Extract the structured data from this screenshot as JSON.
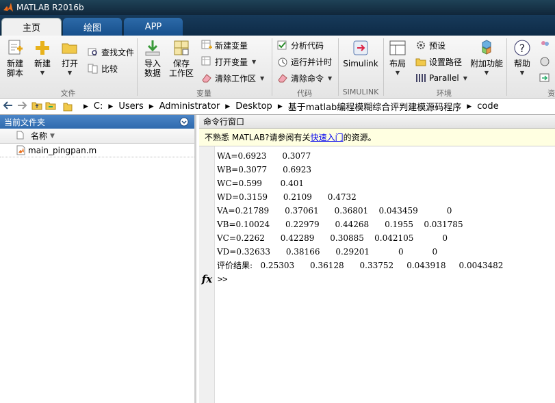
{
  "window": {
    "title": "MATLAB R2016b"
  },
  "tabs": [
    {
      "label": "主页"
    },
    {
      "label": "绘图"
    },
    {
      "label": "APP"
    }
  ],
  "ribbon": {
    "file": {
      "new_script": "新建\n脚本",
      "new": "新建",
      "open": "打开",
      "find_files": "查找文件",
      "compare": "比较",
      "group_label": "文件"
    },
    "variable": {
      "import": "导入\n数据",
      "save_workspace": "保存\n工作区",
      "new_variable": "新建变量",
      "open_variable": "打开变量",
      "clear_workspace": "清除工作区",
      "group_label": "变量"
    },
    "code": {
      "analyze": "分析代码",
      "run_time": "运行并计时",
      "clear_commands": "清除命令",
      "group_label": "代码"
    },
    "simulink": {
      "simulink": "Simulink",
      "group_label": "SIMULINK"
    },
    "env": {
      "layout": "布局",
      "preferences": "预设",
      "set_path": "设置路径",
      "parallel": "Parallel",
      "addons": "附加功能",
      "group_label": "环境"
    },
    "resources": {
      "help": "帮助",
      "group_label": "资"
    }
  },
  "address": {
    "segments": [
      "C:",
      "Users",
      "Administrator",
      "Desktop",
      "基于matlab编程模糊综合评判建模源码程序",
      "code"
    ]
  },
  "current_folder": {
    "title": "当前文件夹",
    "column_name": "名称",
    "files": [
      {
        "name": "main_pingpan.m"
      }
    ]
  },
  "command_window": {
    "title": "命令行窗口",
    "notice_prefix": "不熟悉 MATLAB?请参阅有关",
    "notice_link": "快速入门",
    "notice_suffix": "的资源。",
    "output": [
      "WA=0.6923      0.3077",
      "WB=0.3077      0.6923",
      "WC=0.599       0.401",
      "WD=0.3159      0.2109      0.4732",
      "VA=0.21789      0.37061      0.36801    0.043459           0",
      "VB=0.10024      0.22979      0.44268      0.1955    0.031785",
      "VC=0.2262      0.42289      0.30885    0.042105           0",
      "VD=0.32633      0.38166      0.29201           0           0",
      "评价结果:   0.25303      0.36128      0.33752     0.043918     0.0043482"
    ],
    "prompt": ">>",
    "fx": "fx"
  },
  "colors": {
    "title_bar": "#10263a",
    "panel_header": "#2f6aad",
    "notice_bg": "#ffffe1",
    "link": "#0000ee"
  }
}
